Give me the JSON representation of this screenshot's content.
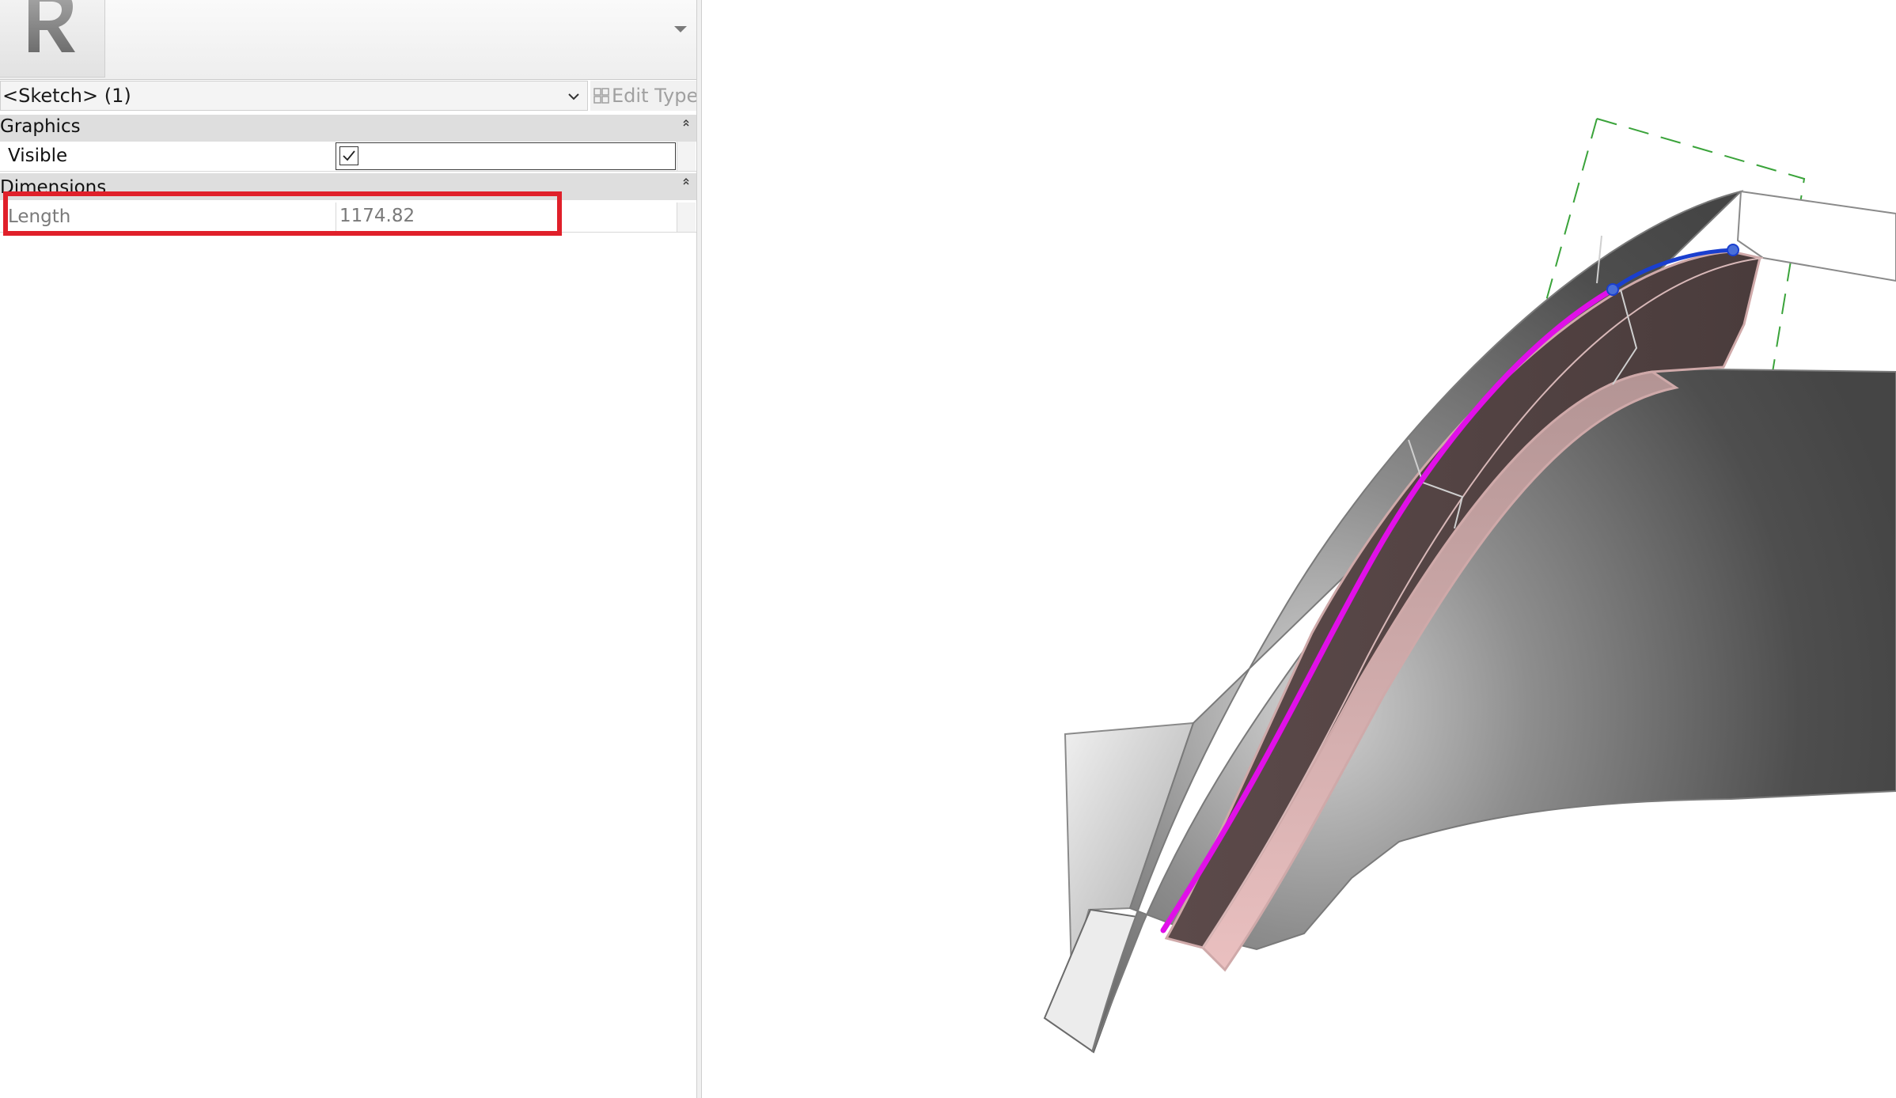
{
  "type_selector": {
    "thumbnail_icon": "revit-r-logo-icon",
    "dropdown_icon": "triangle-down-icon"
  },
  "instance_selector": {
    "value": "<Sketch> (1)",
    "chevron_icon": "chevron-down-icon",
    "edit_type_label": "Edit Type",
    "edit_type_icon": "edit-type-icon"
  },
  "categories": {
    "graphics": {
      "label": "Graphics",
      "rows": {
        "visible": {
          "label": "Visible",
          "checked": true
        }
      }
    },
    "dimensions": {
      "label": "Dimensions",
      "rows": {
        "length": {
          "label": "Length",
          "value": "1174.82"
        }
      }
    }
  },
  "annotation": {
    "highlight_color": "#e0202a"
  },
  "viewport": {
    "selected_curve_color": "#e010e8",
    "secondary_curve_color": "#1a3fcf",
    "workplane_color": "#3aa33a",
    "mass_face_color": "#e8bcbc"
  }
}
